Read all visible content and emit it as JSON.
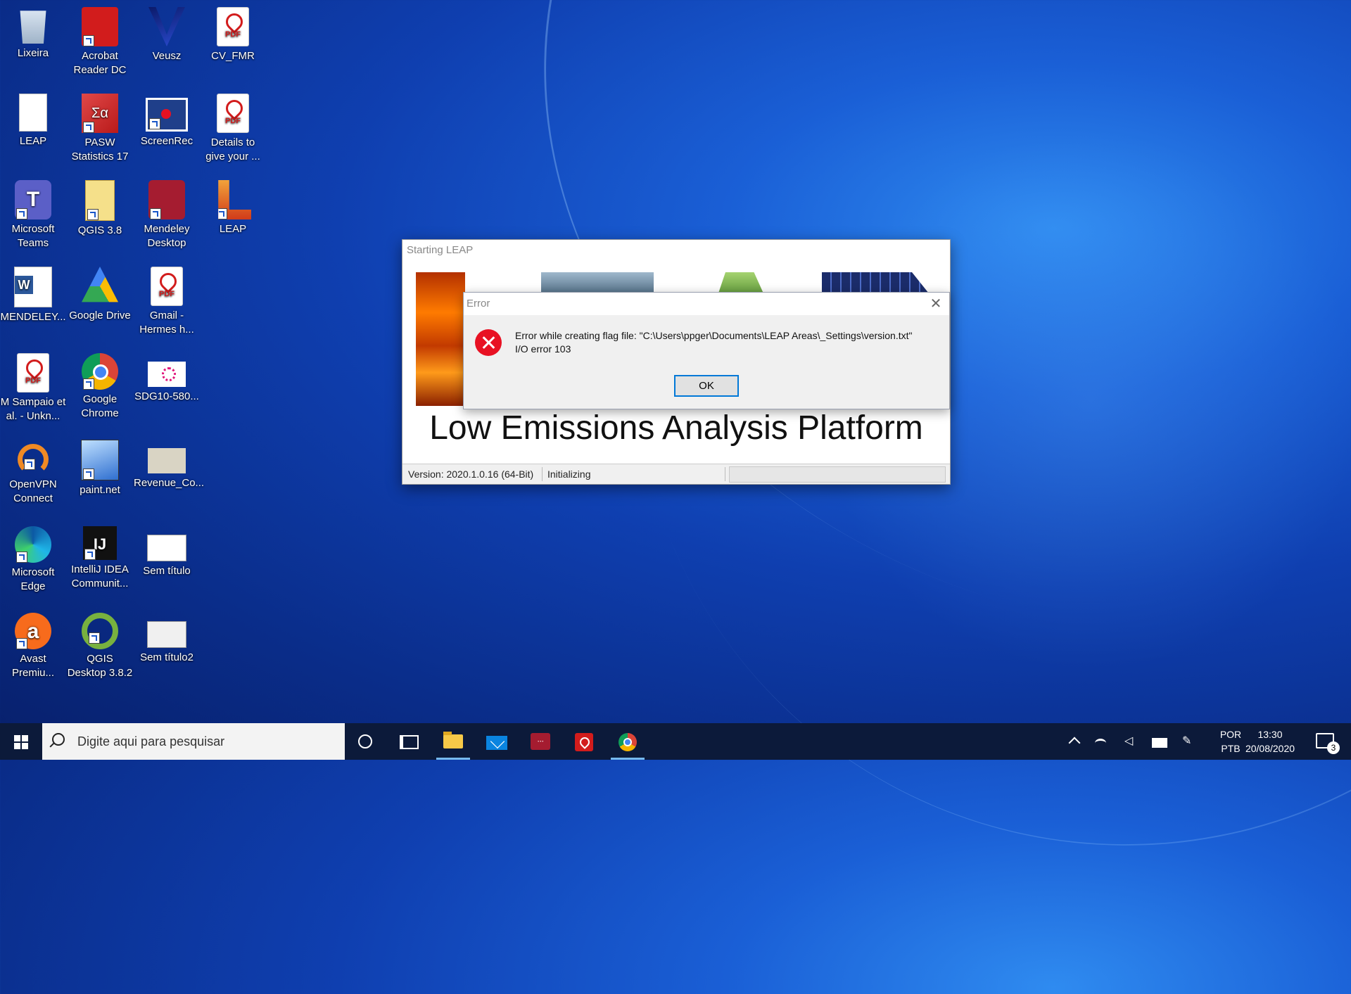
{
  "desktop": {
    "icons": [
      {
        "label": "Lixeira"
      },
      {
        "label": "Acrobat Reader DC"
      },
      {
        "label": "Veusz"
      },
      {
        "label": "CV_FMR"
      },
      {
        "label": "LEAP"
      },
      {
        "label": "PASW Statistics 17"
      },
      {
        "label": "ScreenRec"
      },
      {
        "label": "Details to give your ..."
      },
      {
        "label": "Microsoft Teams"
      },
      {
        "label": "QGIS 3.8"
      },
      {
        "label": "Mendeley Desktop"
      },
      {
        "label": "LEAP"
      },
      {
        "label": "MENDELEY..."
      },
      {
        "label": "Google Drive"
      },
      {
        "label": "Gmail - Hermes h..."
      },
      {
        "label": "M Sampaio et al. - Unkn..."
      },
      {
        "label": "Google Chrome"
      },
      {
        "label": "SDG10-580..."
      },
      {
        "label": "OpenVPN Connect"
      },
      {
        "label": "paint.net"
      },
      {
        "label": "Revenue_Co..."
      },
      {
        "label": "Microsoft Edge"
      },
      {
        "label": "IntelliJ IDEA Communit..."
      },
      {
        "label": "Sem título"
      },
      {
        "label": "Avast Premiu..."
      },
      {
        "label": "QGIS Desktop 3.8.2"
      },
      {
        "label": "Sem título2"
      }
    ],
    "pdf_badge": "PDF"
  },
  "splash": {
    "title": "Starting LEAP",
    "platform_name": "Low Emissions Analysis Platform",
    "version": "Version: 2020.1.0.16 (64-Bit)",
    "status": "Initializing",
    "progress": 0
  },
  "error_dialog": {
    "title": "Error",
    "message_line1": "Error while creating flag file: \"C:\\Users\\ppger\\Documents\\LEAP Areas\\_Settings\\version.txt\"",
    "message_line2": "I/O error 103",
    "ok_label": "OK"
  },
  "taskbar": {
    "search_placeholder": "Digite aqui para pesquisar",
    "lang_line1": "POR",
    "lang_line2": "PTB",
    "time": "13:30",
    "date": "20/08/2020",
    "notification_count": "3",
    "mendeley_glyph": "ᐧᐧᐧ"
  }
}
